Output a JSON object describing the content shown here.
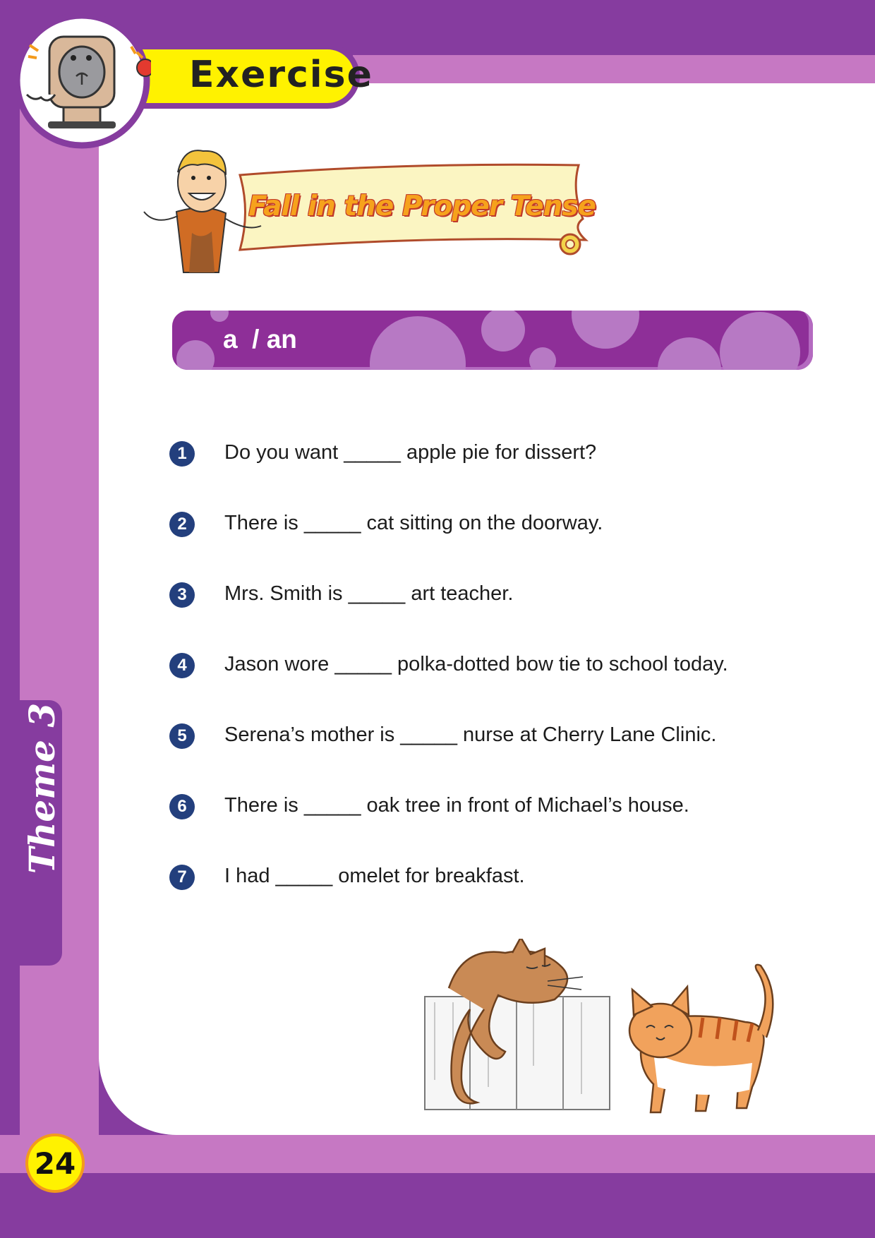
{
  "header": {
    "label": "Exercise"
  },
  "banner": {
    "title": "Fall in the Proper Tense"
  },
  "section": {
    "label": "a  / an"
  },
  "questions": [
    {
      "number": "1",
      "text": "Do you want _____ apple pie for dissert?"
    },
    {
      "number": "2",
      "text": "There is _____ cat sitting on the doorway."
    },
    {
      "number": "3",
      "text": "Mrs. Smith is _____ art teacher."
    },
    {
      "number": "4",
      "text": "Jason wore _____ polka-dotted bow tie to school today."
    },
    {
      "number": "5",
      "text": "Serena’s mother is _____ nurse at Cherry Lane Clinic."
    },
    {
      "number": "6",
      "text": "There is _____ oak tree in front of Michael’s house."
    },
    {
      "number": "7",
      "text": "I had _____ omelet for breakfast."
    }
  ],
  "sidebar": {
    "theme": "Theme 3"
  },
  "footer": {
    "page_number": "24"
  },
  "colors": {
    "purple": "#863c9f",
    "lilac": "#c678c3",
    "yellow": "#fff200",
    "navy": "#233f7d",
    "orange": "#f6a21c"
  },
  "icons": [
    "mascot-icon",
    "boy-icon",
    "cat-icon"
  ]
}
